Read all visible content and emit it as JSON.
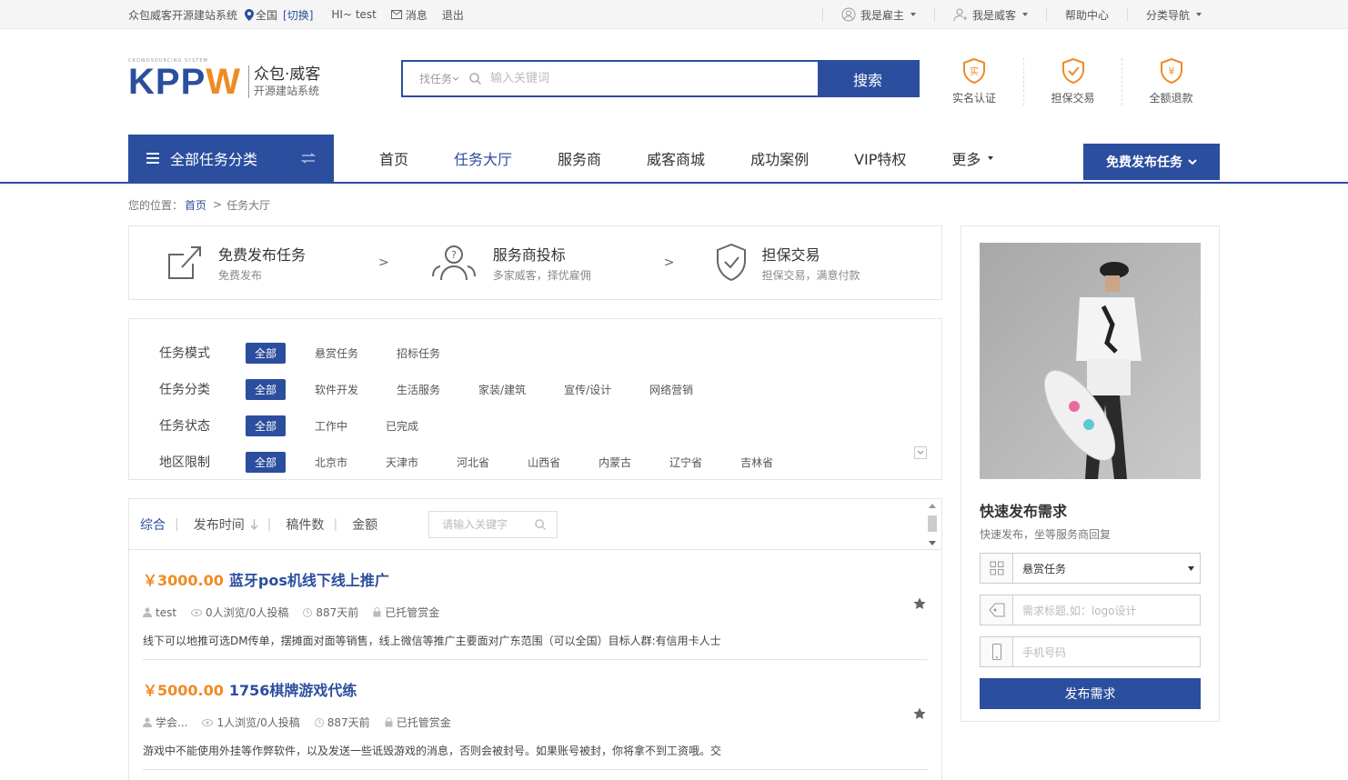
{
  "topbar": {
    "site_name": "众包威客开源建站系统",
    "location": "全国",
    "switch": "[切换]",
    "greeting": "HI~ test",
    "messages": "消息",
    "logout": "退出",
    "employer": "我是雇主",
    "worker": "我是威客",
    "help": "帮助中心",
    "category_nav": "分类导航"
  },
  "logo": {
    "brand": "KPPW",
    "tagline_small": "CROWDSOURCING SYSTEM",
    "line1": "众包·威客",
    "line2": "开源建站系统"
  },
  "search": {
    "type": "找任务",
    "placeholder": "输入关键词",
    "button": "搜索"
  },
  "guarantees": [
    {
      "label": "实名认证",
      "glyph": "实",
      "icon": "shield-verify-icon"
    },
    {
      "label": "担保交易",
      "glyph": "✓",
      "icon": "shield-check-icon"
    },
    {
      "label": "全额退款",
      "glyph": "¥",
      "icon": "shield-refund-icon"
    }
  ],
  "nav": {
    "all_categories": "全部任务分类",
    "items": [
      "首页",
      "任务大厅",
      "服务商",
      "威客商城",
      "成功案例",
      "VIP特权",
      "更多"
    ],
    "active_index": 1,
    "publish_button": "免费发布任务"
  },
  "breadcrumb": {
    "prefix": "您的位置：",
    "home": "首页",
    "sep": ">",
    "current": "任务大厅"
  },
  "steps": [
    {
      "title": "免费发布任务",
      "sub": "免费发布"
    },
    {
      "title": "服务商投标",
      "sub": "多家威客，择优雇佣"
    },
    {
      "title": "担保交易",
      "sub": "担保交易，满意付款"
    }
  ],
  "step_arrow": ">",
  "filters": [
    {
      "label": "任务模式",
      "options": [
        "全部",
        "悬赏任务",
        "招标任务"
      ]
    },
    {
      "label": "任务分类",
      "options": [
        "全部",
        "软件开发",
        "生活服务",
        "家装/建筑",
        "宣传/设计",
        "网络营销"
      ]
    },
    {
      "label": "任务状态",
      "options": [
        "全部",
        "工作中",
        "已完成"
      ]
    },
    {
      "label": "地区限制",
      "options": [
        "全部",
        "北京市",
        "天津市",
        "河北省",
        "山西省",
        "内蒙古",
        "辽宁省",
        "吉林省"
      ]
    }
  ],
  "sort": {
    "items": [
      "综合",
      "发布时间",
      "稿件数",
      "金额"
    ],
    "keyword_placeholder": "请输入关键字"
  },
  "tasks": [
    {
      "price": "￥3000.00",
      "title": "蓝牙pos机线下线上推广",
      "user": "test",
      "views": "0人浏览/0人投稿",
      "time": "887天前",
      "escrow": "已托管赏金",
      "desc": "线下可以地推可选DM传单，摆摊面对面等销售，线上微信等推广主要面对广东范围（可以全国）目标人群:有信用卡人士"
    },
    {
      "price": "￥5000.00",
      "title": "1756棋牌游戏代练",
      "user": "学会...",
      "views": "1人浏览/0人投稿",
      "time": "887天前",
      "escrow": "已托管赏金",
      "desc": "游戏中不能使用外挂等作弊软件，以及发送一些诋毁游戏的消息，否则会被封号。如果账号被封，你将拿不到工资哦。交"
    }
  ],
  "quick_publish": {
    "title": "快速发布需求",
    "sub": "快速发布，坐等服务商回复",
    "type_value": "悬赏任务",
    "title_placeholder": "需求标题,如：logo设计",
    "phone_placeholder": "手机号码",
    "button": "发布需求"
  },
  "colors": {
    "primary": "#2b4e9e",
    "accent": "#f08a24"
  }
}
